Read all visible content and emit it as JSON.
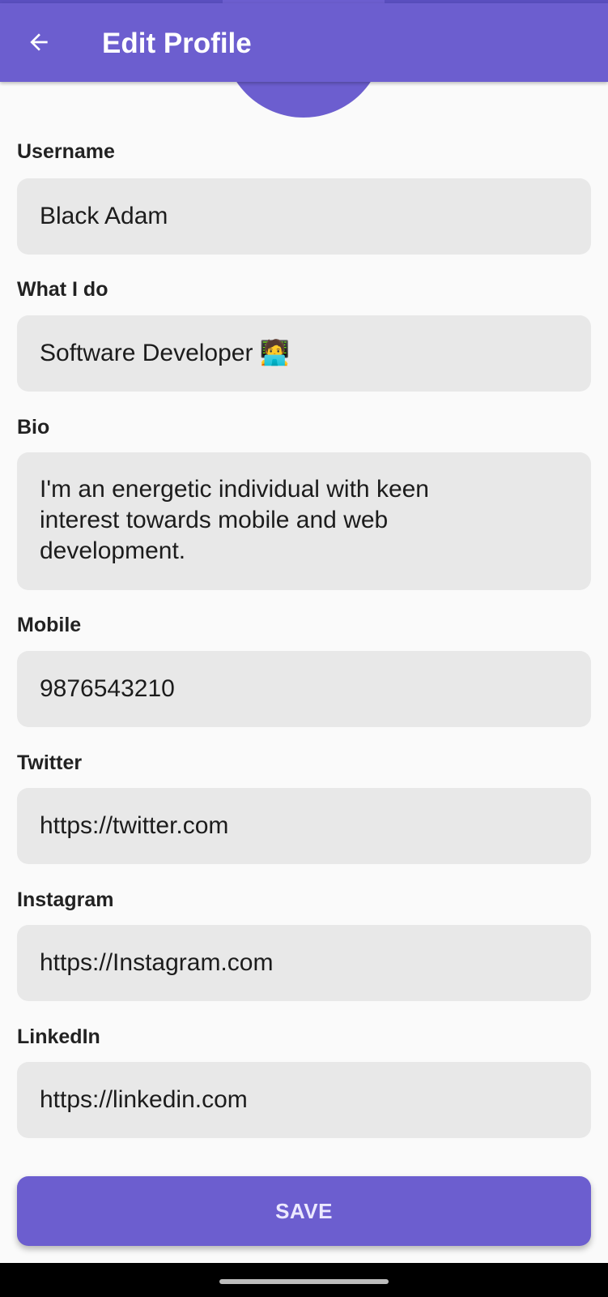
{
  "appbar": {
    "title": "Edit Profile",
    "back_icon": "arrow-back-icon"
  },
  "colors": {
    "primary": "#6c5ecf",
    "field_bg": "#e8e8e8",
    "background": "#fafafa"
  },
  "fields": {
    "username": {
      "label": "Username",
      "value": "Black Adam"
    },
    "what_i_do": {
      "label": "What I do",
      "value": "Software Developer 🧑‍💻"
    },
    "bio": {
      "label": "Bio",
      "value": "I'm an energetic individual with keen interest towards mobile and web development."
    },
    "mobile": {
      "label": "Mobile",
      "value": "9876543210"
    },
    "twitter": {
      "label": "Twitter",
      "value": "https://twitter.com"
    },
    "instagram": {
      "label": "Instagram",
      "value": "https://Instagram.com"
    },
    "linkedin": {
      "label": "LinkedIn",
      "value": "https://linkedin.com"
    }
  },
  "save_label": "SAVE"
}
